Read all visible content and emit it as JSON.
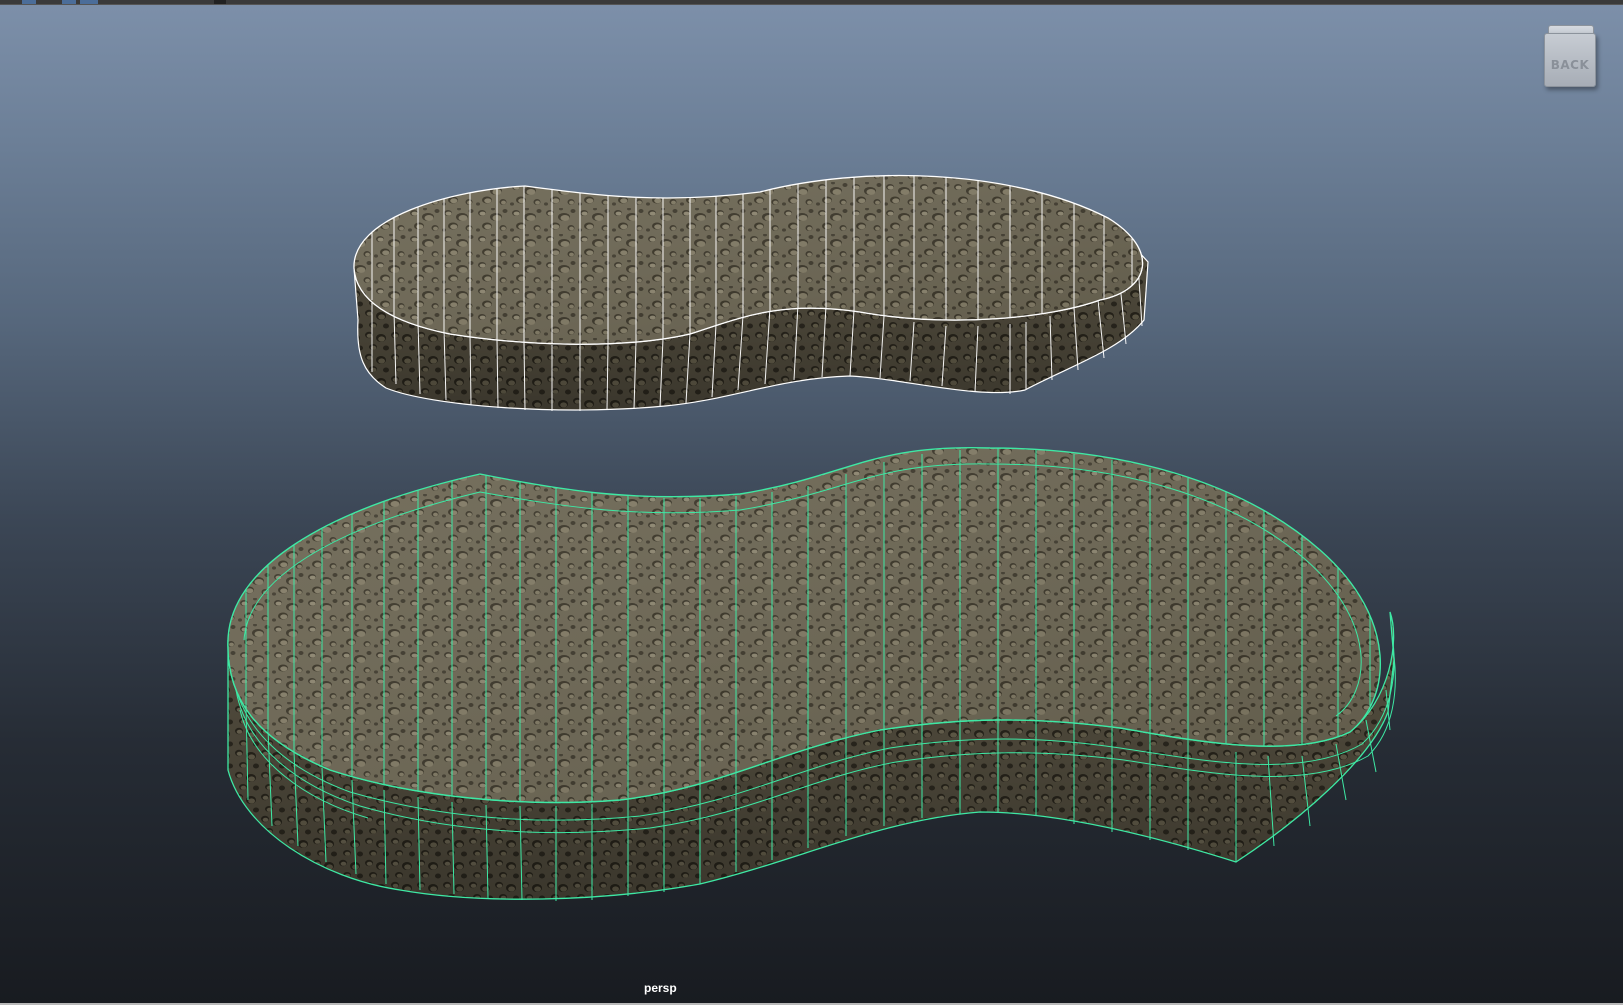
{
  "viewport": {
    "camera_label": "persp",
    "background_top": "#7d90aa",
    "background_bottom": "#181b20"
  },
  "viewcube": {
    "label": "BACK"
  },
  "objects": [
    {
      "name": "upper-sponge",
      "selected": false,
      "wireframe_color": "#ffffff"
    },
    {
      "name": "lower-sponge",
      "selected": true,
      "wireframe_color": "#3ee8a4"
    }
  ],
  "material": {
    "texture": "porous-sponge",
    "base_color": "#6b6552",
    "side_color": "#4f4a3c"
  }
}
